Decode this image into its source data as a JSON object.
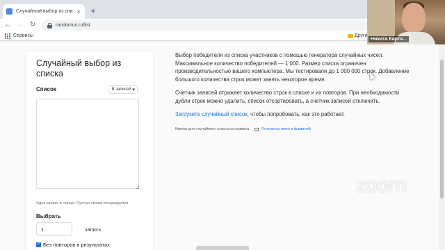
{
  "browser": {
    "tab_title": "Случайный выбор из списка | К",
    "tab_close": "×",
    "new_tab": "+",
    "url": "randomus.ru/list",
    "back": "←",
    "forward": "→",
    "reload": "↻",
    "bookmarks": {
      "services": "Сервисы",
      "other": "Другие"
    }
  },
  "webcam": {
    "participant_name": "Никита Карта..."
  },
  "form": {
    "title": "Случайный выбор из списка",
    "list_label": "Список",
    "records_count": "0",
    "records_word": "записей",
    "chevron": "▾",
    "list_value": "",
    "hint": "Одна запись в строке. Пустые строки игнорируются.",
    "choose_label": "Выбрать",
    "choose_value": "1",
    "choose_unit": "запись",
    "no_repeat_checked": true,
    "no_repeat_mark": "✓",
    "no_repeat_label": "Без повторов в результатах"
  },
  "description": {
    "p1": "Выбор победителя из списка участников с помощью генератора случайных чисел. Максимальное количество победителей — 1 000. Размер списка ограничен производительностью вашего компьютера. Мы тестировали до 1 000 000 строк. Добавление большого количества строк может занять некоторое время.",
    "p2": "Счетчик записей отражает количество строк в списке и их повторов. При необходимости дубли строк можно удалить, список отсортировать, а счетчик записей отключить.",
    "p3_link": "Загрузите случайный список",
    "p3_rest": ", чтобы попробовать, как это работает.",
    "meta_text": "Имена для случайного списка из сервиса",
    "meta_link": "Генератор имен и фамилий"
  },
  "watermark": "zoom",
  "colors": {
    "accent": "#1a73e8",
    "checkbox": "#1a73e8"
  }
}
